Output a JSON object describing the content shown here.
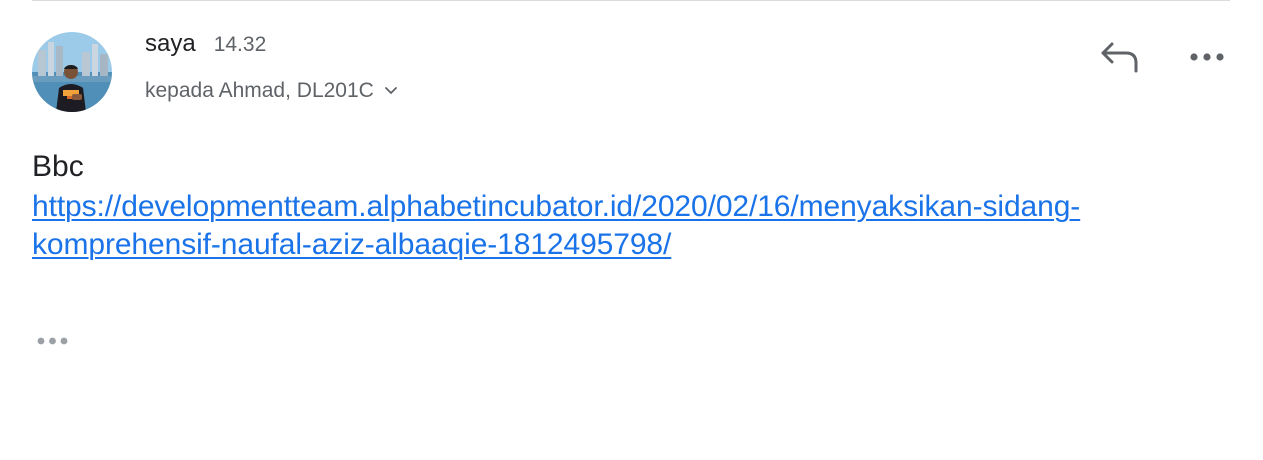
{
  "message": {
    "sender_name": "saya",
    "timestamp": "14.32",
    "recipients": "kepada Ahmad, DL201C",
    "body_text": "Bbc",
    "link": {
      "line1": "https://developmentteam.alphabetincubator.id/2020/02/16/menyaksikan-sidang-",
      "line2": "komprehensif-naufal-aziz-albaaqie-1812495798/"
    }
  },
  "icons": {
    "avatar": "avatar-photo",
    "recipients_toggle": "chevron-down-icon",
    "reply": "reply-icon",
    "more": "more-horizontal-icon",
    "trimmed_content": "ellipsis-icon"
  },
  "colors": {
    "link": "#1a73e8",
    "secondary_text": "#5f6368",
    "icon": "#5f6368",
    "trimmed_dots": "#9aa0a6"
  }
}
